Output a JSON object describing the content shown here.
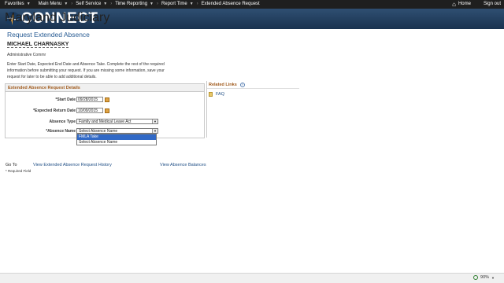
{
  "topnav": {
    "favorites": "Favorites",
    "main_menu": "Main Menu",
    "self_service": "Self Service",
    "time_reporting": "Time Reporting",
    "report_time": "Report Time",
    "current": "Extended Absence Request",
    "home": "Home",
    "sign_out": "Sign out"
  },
  "banner": {
    "logo_word": "CONNECT",
    "logo_tag": "Maryland Judiciary"
  },
  "page": {
    "title": "Request Extended Absence",
    "employee_name": "MICHAEL CHARNASKY",
    "job_title": "Administrative Commr",
    "instructions": "Enter Start Date, Expected End Date and Absence Take. Complete the rest of the required information before submitting your request. If you are missing some information, save your request for later to be able to add additional details."
  },
  "details": {
    "header": "Extended Absence Request Details",
    "start_date_label": "*Start Date",
    "start_date_value": "09/28/2015",
    "return_date_label": "*Expected Return Date",
    "return_date_value": "10/09/2015",
    "absence_type_label": "Absence Type",
    "absence_type_value": "Family and Medical Leave Act",
    "absence_name_label": "*Absence Name",
    "absence_name_value": "Select Absence Name",
    "absence_name_options": [
      "FMLA Take",
      "Select Absence Name"
    ]
  },
  "related_links": {
    "header": "Related Links",
    "faq": "FAQ"
  },
  "footer": {
    "goto": "Go To",
    "history_link": "View Extended Absence Request History",
    "balances_link": "View Absence Balances",
    "required_note": "* Required Field"
  },
  "statusbar": {
    "zoom": "90%"
  },
  "colors": {
    "nav_bg": "#1f1f1f",
    "banner_bg": "#19324f",
    "title_blue": "#2a5d94",
    "section_orange": "#a05a1c",
    "link_blue": "#1f4e85",
    "selection_blue": "#3169c6"
  }
}
